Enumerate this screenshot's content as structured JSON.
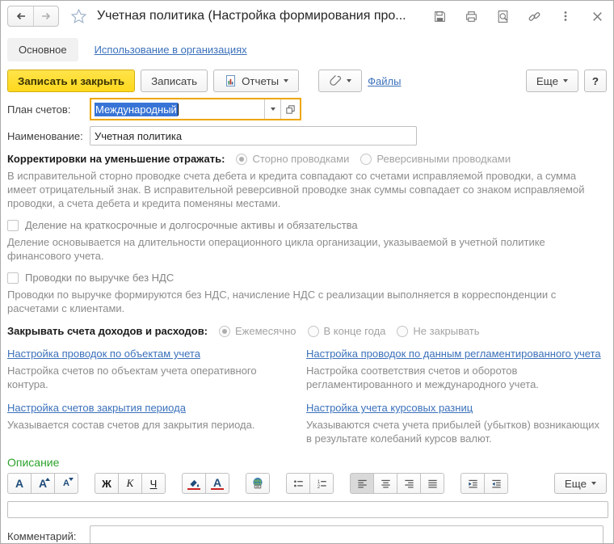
{
  "window": {
    "title": "Учетная политика (Настройка формирования про..."
  },
  "tabs": {
    "main": "Основное",
    "usage": "Использование в организациях"
  },
  "command_bar": {
    "save_close": "Записать и закрыть",
    "save": "Записать",
    "reports": "Отчеты",
    "files": "Файлы",
    "more": "Еще",
    "help": "?"
  },
  "form": {
    "chart_of_accounts": {
      "label": "План счетов:",
      "value": "Международный"
    },
    "name": {
      "label": "Наименование:",
      "value": "Учетная политика"
    },
    "adjustments": {
      "label": "Корректировки на уменьшение отражать:",
      "options": [
        "Сторно проводками",
        "Реверсивными проводками"
      ],
      "selected": "Сторно проводками",
      "hint": "В исправительной сторно проводке счета дебета и кредита совпадают со счетами исправляемой проводки, а сумма имеет отрицательный знак. В исправительной реверсивной проводке знак суммы совпадает со знаком исправляемой проводки, а счета дебета и кредита поменяны местами."
    },
    "division": {
      "label": "Деление на краткосрочные и долгосрочные активы и обязательства",
      "checked": false,
      "hint": "Деление основывается на длительности операционного цикла организации, указываемой в учетной политике финансового учета."
    },
    "vat": {
      "label": "Проводки по выручке без НДС",
      "checked": false,
      "hint": "Проводки по выручке формируются без НДС, начисление НДС с реализации выполняется в корреспонденции с расчетами с клиентами."
    },
    "closing": {
      "label": "Закрывать счета доходов и расходов:",
      "options": [
        "Ежемесячно",
        "В конце года",
        "Не закрывать"
      ],
      "selected": "Ежемесячно"
    },
    "links": [
      {
        "title": "Настройка проводок по объектам учета",
        "desc": "Настройка счетов по объектам учета оперативного контура."
      },
      {
        "title": "Настройка проводок по данным регламентированного учета",
        "desc": "Настройка соответствия счетов и оборотов регламентированного и международного учета."
      },
      {
        "title": "Настройка счетов закрытия периода",
        "desc": "Указывается состав счетов для закрытия периода."
      },
      {
        "title": "Настройка учета курсовых разниц",
        "desc": "Указываются счета учета прибылей (убытков) возникающих в результате колебаний курсов валют."
      }
    ],
    "description": {
      "title": "Описание",
      "content": "",
      "more": "Еще"
    },
    "comment": {
      "label": "Комментарий:",
      "value": ""
    }
  },
  "editor": {
    "font_letter": "A",
    "bold": "Ж",
    "italic": "К",
    "underline": "Ч",
    "color_letter": "A"
  },
  "colors": {
    "accent_yellow": "#ffd91e",
    "focus_orange": "#eda600",
    "link_blue": "#3b71bb",
    "section_green": "#2da32d",
    "selection_blue": "#3874d6"
  }
}
